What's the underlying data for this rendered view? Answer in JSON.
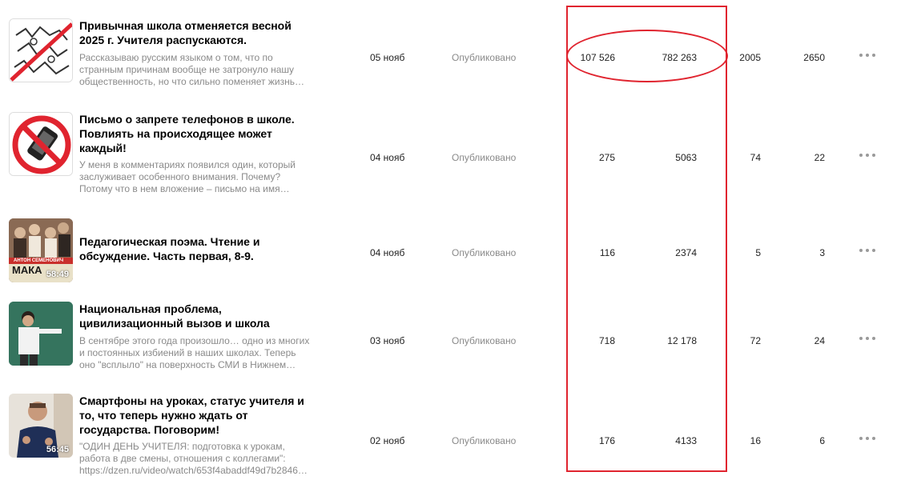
{
  "articles": [
    {
      "title": "Привычная школа отменяется весной 2025 г. Учителя распускаются.",
      "snippet": "Рассказываю русским языком о том, что по странным причинам вообще не затронуло нашу общественность, но что сильно поменяет жизнь…",
      "date": "05 нояб",
      "status": "Опубликовано",
      "views": "107 526",
      "impressions": "782 263",
      "reads": "2005",
      "comments": "2650",
      "thumb_icon": "crossed-out-drawing-icon",
      "duration": ""
    },
    {
      "title": "Письмо о запрете телефонов в школе. Повлиять на происходящее может каждый!",
      "snippet": "У меня в комментариях появился один, который заслуживает особенного внимания. Почему? Потому что в нем вложение – письмо на имя…",
      "date": "04 нояб",
      "status": "Опубликовано",
      "views": "275",
      "impressions": "5063",
      "reads": "74",
      "comments": "22",
      "thumb_icon": "no-phone-icon",
      "duration": ""
    },
    {
      "title": "Педагогическая поэма. Чтение и обсуждение. Часть первая, 8-9.",
      "snippet": "",
      "date": "04 нояб",
      "status": "Опубликовано",
      "views": "116",
      "impressions": "2374",
      "reads": "5",
      "comments": "3",
      "thumb_icon": "book-cover-icon",
      "thumb_caption": "АНТОН СЕМЕНОВИЧ",
      "thumb_caption2": "МАКА",
      "duration": "58:49"
    },
    {
      "title": "Национальная проблема, цивилизационный вызов и школа",
      "snippet": "В сентябре этого года произошло… одно из многих и постоянных избиений в наших школах. Теперь оно \"всплыло\" на поверхность СМИ в Нижнем…",
      "date": "03 нояб",
      "status": "Опубликовано",
      "views": "718",
      "impressions": "12 178",
      "reads": "72",
      "comments": "24",
      "thumb_icon": "classroom-photo-icon",
      "duration": ""
    },
    {
      "title": "Смартфоны на уроках, статус учителя и то, что теперь нужно ждать от государства. Поговорим!",
      "snippet": "\"ОДИН ДЕНЬ УЧИТЕЛЯ: подготовка к урокам, работа в две смены, отношения с коллегами\": https://dzen.ru/video/watch/653f4abaddf49d7b2846…",
      "date": "02 нояб",
      "status": "Опубликовано",
      "views": "176",
      "impressions": "4133",
      "reads": "16",
      "comments": "6",
      "thumb_icon": "speaker-video-icon",
      "duration": "56:45"
    }
  ],
  "colors": {
    "highlight": "#e0242f",
    "muted": "#8a8a8a"
  }
}
